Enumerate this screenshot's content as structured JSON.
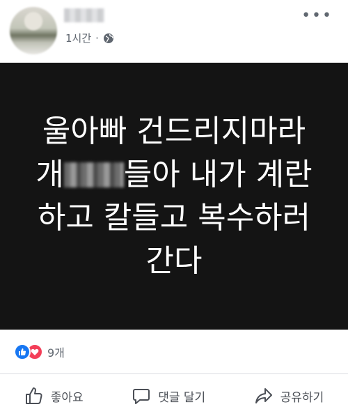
{
  "post": {
    "time": "1시간",
    "separator": "·",
    "image_text": {
      "line1": "울아빠 건드리지마라",
      "line2_prefix": "개",
      "line2_suffix": "들아 내가 계란",
      "line3": "하고 칼들고 복수하러",
      "line4": "간다"
    }
  },
  "reactions": {
    "count": "9개",
    "types": [
      "like",
      "love"
    ]
  },
  "actions": {
    "like": {
      "label": "좋아요",
      "icon": "thumbs-up-icon"
    },
    "comment": {
      "label": "댓글 달기",
      "icon": "comment-icon"
    },
    "share": {
      "label": "공유하기",
      "icon": "share-icon"
    }
  },
  "colors": {
    "like": "#1877f2",
    "love": "#f33e58",
    "image_bg": "#141414",
    "muted": "#606770"
  }
}
